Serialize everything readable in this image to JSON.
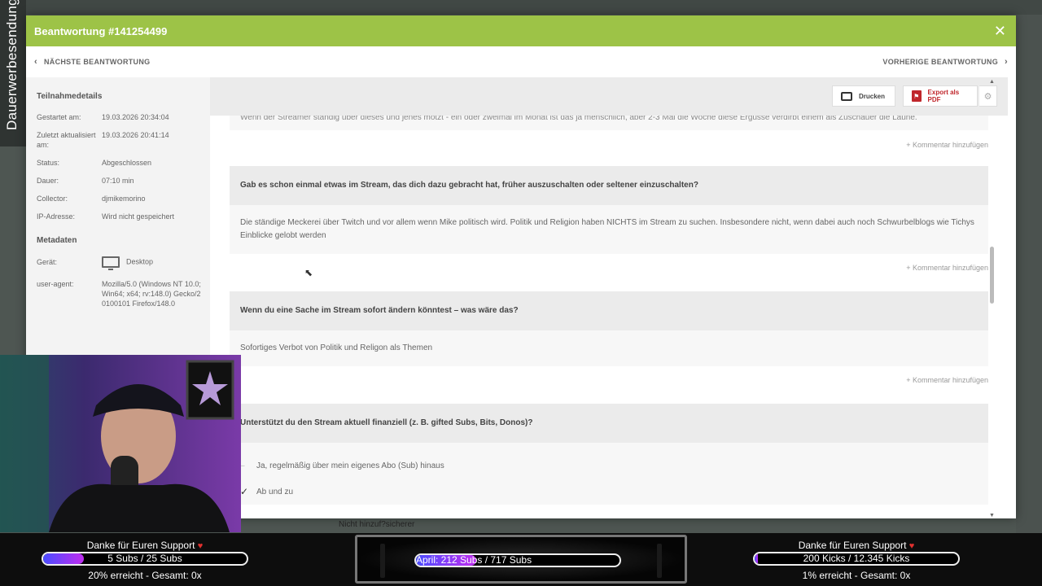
{
  "overlay": {
    "side_label": "Dauerwerbesendung",
    "bg_bottom_text": "Nicht hinzuf?sicherer"
  },
  "modal": {
    "title": "Beantwortung #141254499",
    "close_icon": "close-icon",
    "nav_next": "NÄCHSTE BEANTWORTUNG",
    "nav_prev": "VORHERIGE BEANTWORTUNG"
  },
  "details": {
    "section_title": "Teilnahmedetails",
    "rows": [
      {
        "k": "Gestartet am:",
        "v": "19.03.2026 20:34:04"
      },
      {
        "k": "Zuletzt aktualisiert am:",
        "v": "19.03.2026 20:41:14"
      },
      {
        "k": "Status:",
        "v": "Abgeschlossen"
      },
      {
        "k": "Dauer:",
        "v": "07:10 min"
      },
      {
        "k": "Collector:",
        "v": "djmikemorino"
      },
      {
        "k": "IP-Adresse:",
        "v": "Wird nicht gespeichert"
      }
    ],
    "meta_title": "Metadaten",
    "device_label": "Gerät:",
    "device_value": "Desktop",
    "ua_label": "user-agent:",
    "ua_value": "Mozilla/5.0 (Windows NT 10.0; Win64; x64; rv:148.0) Gecko/20100101 Firefox/148.0"
  },
  "toolbar": {
    "print_label": "Drucken",
    "pdf_label": "Export als PDF"
  },
  "responses": {
    "cut_answer": "Wenn der Streamer ständig über dieses und jenes motzt - ein oder zweimal im Monat ist das ja menschlich, aber 2-3 Mal die Woche diese Ergüsse verdirbt einem als Zuschauer die Laune.",
    "comment_label": "+ Kommentar hinzufügen",
    "q1": "Gab es schon einmal etwas im Stream, das dich dazu gebracht hat, früher auszuschalten oder seltener einzuschalten?",
    "a1": "Die ständige Meckerei über Twitch und vor allem wenn Mike politisch wird. Politik und Religion haben NICHTS im Stream zu suchen. Insbesondere nicht, wenn dabei auch noch Schwurbelblogs wie Tichys Einblicke gelobt werden",
    "q2": "Wenn du eine Sache im Stream sofort ändern könntest – was wäre das?",
    "a2": "Sofortiges Verbot von Politik und Religon als Themen",
    "q3": "Unterstützt du den Stream aktuell finanziell (z. B. gifted Subs, Bits, Donos)?",
    "choice1": "Ja, regelmäßig über mein eigenes Abo (Sub) hinaus",
    "choice2": "Ab und zu",
    "choice2_mark": "✓"
  },
  "goals": {
    "left": {
      "title": "Danke für Euren Support",
      "bar": "5 Subs / 25 Subs",
      "progress": 0.2,
      "foot": "20% erreicht - Gesamt: 0x"
    },
    "center": {
      "bar": "April: 212 Subs / 717 Subs",
      "progress": 0.296
    },
    "right": {
      "title": "Danke für Euren Support",
      "bar": "200 Kicks / 12.345 Kicks",
      "progress": 0.016,
      "foot": "1% erreicht - Gesamt: 0x"
    }
  }
}
